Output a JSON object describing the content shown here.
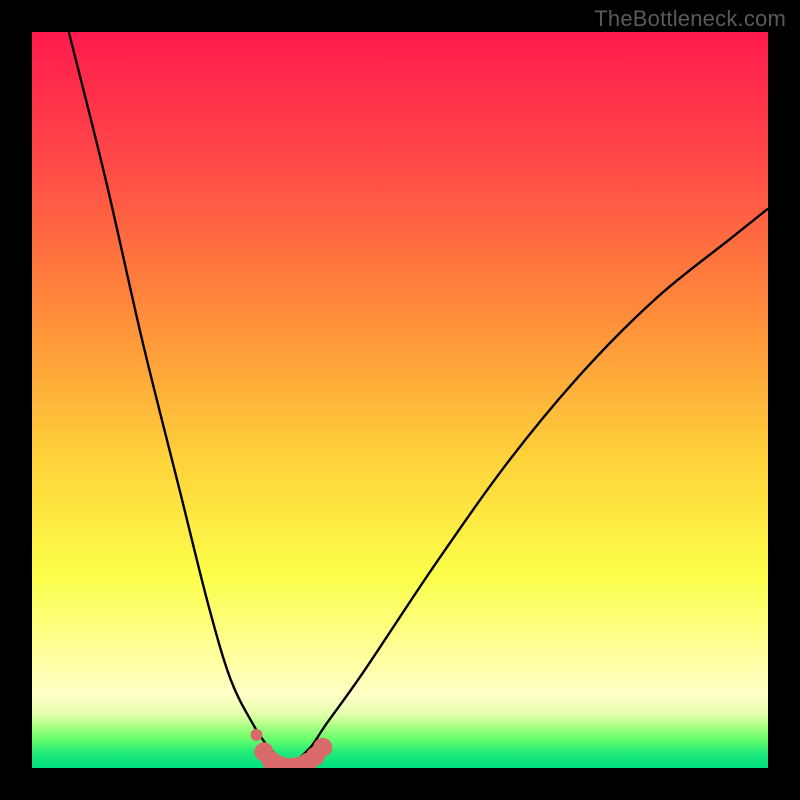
{
  "watermark": "TheBottleneck.com",
  "colors": {
    "frame": "#000000",
    "curve_stroke": "#000000",
    "marker_fill": "#d96a6a",
    "gradient": [
      "#ff1a4d",
      "#ff8b3a",
      "#fcff4a",
      "#ffffc8",
      "#00e080"
    ]
  },
  "notes": "Chart has no visible numeric axis labels or tick marks; the plot is a V-shaped curve over a red→green vertical gradient, with a small cluster of salmon markers at the curve's minimum near the bottom.",
  "chart_data": {
    "type": "line",
    "title": "",
    "xlabel": "",
    "ylabel": "",
    "xlim": [
      0,
      100
    ],
    "ylim": [
      0,
      100
    ],
    "series": [
      {
        "name": "v-curve",
        "x": [
          5,
          10,
          15,
          20,
          24,
          27,
          30,
          32,
          34,
          35,
          36,
          38,
          40,
          45,
          55,
          65,
          75,
          85,
          95,
          100
        ],
        "y": [
          100,
          80,
          58,
          38,
          22,
          12,
          6,
          3,
          1,
          0,
          1,
          3,
          6,
          13,
          28,
          42,
          54,
          64,
          72,
          76
        ]
      }
    ],
    "markers": {
      "name": "salmon-dots-near-minimum",
      "color": "#d96a6a",
      "points": [
        {
          "x": 30.5,
          "y": 4.5
        },
        {
          "x": 31.5,
          "y": 2.2
        },
        {
          "x": 32.5,
          "y": 1.0
        },
        {
          "x": 33.5,
          "y": 0.4
        },
        {
          "x": 34.5,
          "y": 0.1
        },
        {
          "x": 35.5,
          "y": 0.1
        },
        {
          "x": 36.5,
          "y": 0.3
        },
        {
          "x": 37.5,
          "y": 0.8
        },
        {
          "x": 38.5,
          "y": 1.6
        },
        {
          "x": 39.5,
          "y": 2.8
        }
      ]
    }
  }
}
